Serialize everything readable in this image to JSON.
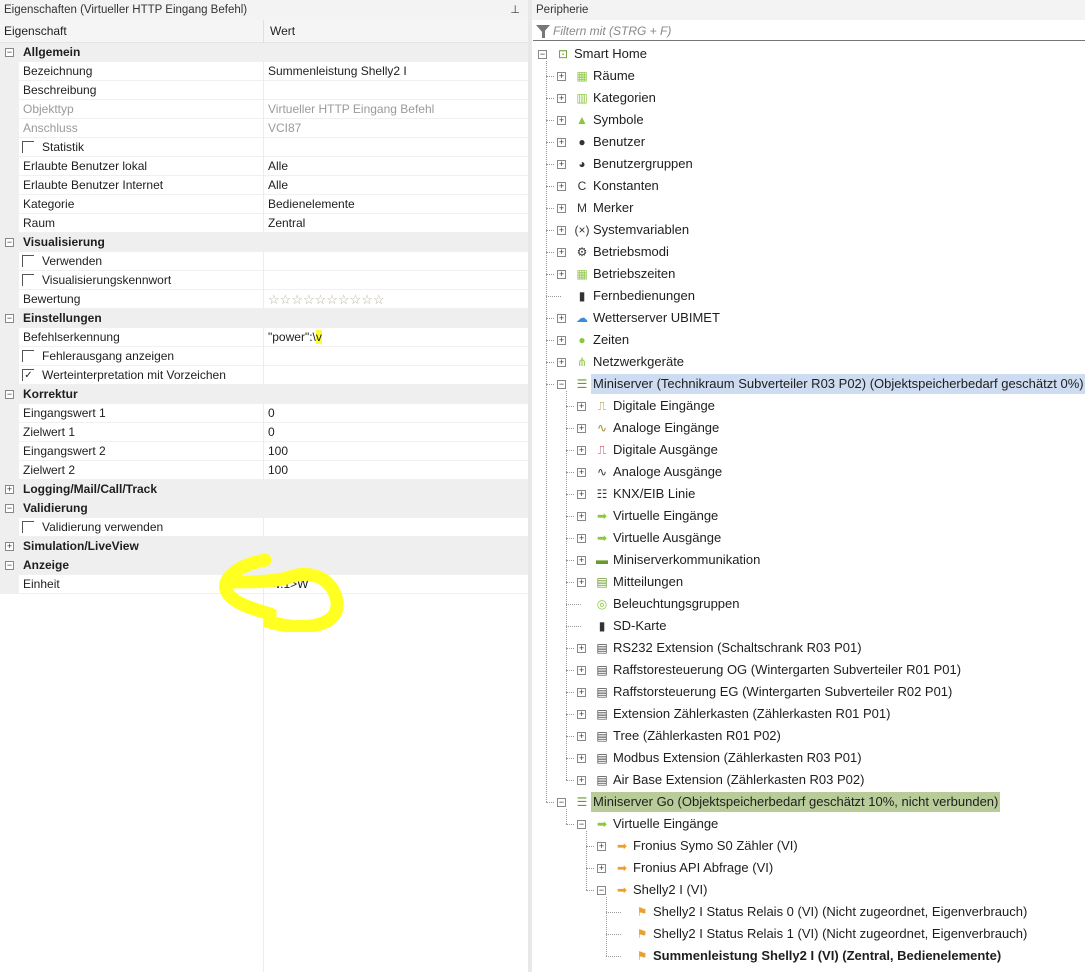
{
  "left": {
    "title": "Eigenschaften (Virtueller HTTP Eingang Befehl)",
    "pin_icon": "pin-icon",
    "col_property": "Eigenschaft",
    "col_value": "Wert",
    "rows": [
      {
        "type": "cat",
        "label": "Allgemein",
        "expanded": true
      },
      {
        "label": "Bezeichnung",
        "value": "Summenleistung Shelly2 I"
      },
      {
        "label": "Beschreibung",
        "value": ""
      },
      {
        "label": "Objekttyp",
        "value": "Virtueller HTTP Eingang Befehl",
        "disabled": true
      },
      {
        "label": "Anschluss",
        "value": "VCI87",
        "disabled": true
      },
      {
        "label": "Statistik",
        "checkbox": true,
        "checked": false
      },
      {
        "label": "Erlaubte Benutzer lokal",
        "value": "Alle"
      },
      {
        "label": "Erlaubte Benutzer Internet",
        "value": "Alle"
      },
      {
        "label": "Kategorie",
        "value": "Bedienelemente"
      },
      {
        "label": "Raum",
        "value": "Zentral"
      },
      {
        "type": "cat",
        "label": "Visualisierung",
        "expanded": true
      },
      {
        "label": "Verwenden",
        "checkbox": true,
        "checked": false
      },
      {
        "label": "Visualisierungskennwort",
        "checkbox": true,
        "checked": false
      },
      {
        "label": "Bewertung",
        "rating": 0,
        "rating_max": 10,
        "stars": "☆☆☆☆☆☆☆☆☆☆"
      },
      {
        "type": "cat",
        "label": "Einstellungen",
        "expanded": true
      },
      {
        "label": "Befehlserkennung",
        "value": "\"power\":\\",
        "value_highlight": "v"
      },
      {
        "label": "Fehlerausgang anzeigen",
        "checkbox": true,
        "checked": false
      },
      {
        "label": "Werteinterpretation mit Vorzeichen",
        "checkbox": true,
        "checked": true
      },
      {
        "type": "cat",
        "label": "Korrektur",
        "expanded": true
      },
      {
        "label": "Eingangswert 1",
        "value": "0"
      },
      {
        "label": "Zielwert 1",
        "value": "0"
      },
      {
        "label": "Eingangswert 2",
        "value": "100"
      },
      {
        "label": "Zielwert 2",
        "value": "100"
      },
      {
        "type": "cat",
        "label": "Logging/Mail/Call/Track",
        "expanded": false
      },
      {
        "type": "cat",
        "label": "Validierung",
        "expanded": true
      },
      {
        "label": "Validierung verwenden",
        "checkbox": true,
        "checked": false
      },
      {
        "type": "cat",
        "label": "Simulation/LiveView",
        "expanded": false
      },
      {
        "type": "cat",
        "label": "Anzeige",
        "expanded": true
      },
      {
        "label": "Einheit",
        "value": "<v.1>W"
      }
    ],
    "annotation_color": "#ffff00"
  },
  "right": {
    "title": "Peripherie",
    "filter_placeholder": "Filtern mit (STRG + F)",
    "tree": [
      {
        "level": 0,
        "exp": "-",
        "icon": "smart-home-icon",
        "glyph": "⊡",
        "color": "#6a9a2a",
        "label": "Smart Home"
      },
      {
        "level": 1,
        "exp": "+",
        "icon": "rooms-icon",
        "glyph": "▦",
        "color": "#8cc63f",
        "label": "Räume"
      },
      {
        "level": 1,
        "exp": "+",
        "icon": "categories-icon",
        "glyph": "▥",
        "color": "#8cc63f",
        "label": "Kategorien"
      },
      {
        "level": 1,
        "exp": "+",
        "icon": "symbols-icon",
        "glyph": "▲",
        "color": "#8cc63f",
        "label": "Symbole"
      },
      {
        "level": 1,
        "exp": "+",
        "icon": "user-icon",
        "glyph": "●",
        "color": "#333",
        "label": "Benutzer"
      },
      {
        "level": 1,
        "exp": "+",
        "icon": "user-group-icon",
        "glyph": "◕",
        "color": "#333",
        "label": "Benutzergruppen"
      },
      {
        "level": 1,
        "exp": "+",
        "icon": "constant-icon",
        "glyph": "C",
        "color": "#333",
        "label": "Konstanten"
      },
      {
        "level": 1,
        "exp": "+",
        "icon": "flag-icon",
        "glyph": "M",
        "color": "#333",
        "label": "Merker"
      },
      {
        "level": 1,
        "exp": "+",
        "icon": "system-variable-icon",
        "glyph": "(×)",
        "color": "#333",
        "label": "Systemvariablen"
      },
      {
        "level": 1,
        "exp": "+",
        "icon": "gear-icon",
        "glyph": "⚙",
        "color": "#333",
        "label": "Betriebsmodi"
      },
      {
        "level": 1,
        "exp": "+",
        "icon": "calendar-icon",
        "glyph": "▦",
        "color": "#8cc63f",
        "label": "Betriebszeiten"
      },
      {
        "level": 1,
        "exp": "",
        "icon": "remote-icon",
        "glyph": "▮",
        "color": "#333",
        "label": "Fernbedienungen"
      },
      {
        "level": 1,
        "exp": "+",
        "icon": "weather-icon",
        "glyph": "☁",
        "color": "#3a8ad8",
        "label": "Wetterserver UBIMET"
      },
      {
        "level": 1,
        "exp": "+",
        "icon": "clock-icon",
        "glyph": "●",
        "color": "#8cc63f",
        "label": "Zeiten"
      },
      {
        "level": 1,
        "exp": "+",
        "icon": "network-icon",
        "glyph": "⋔",
        "color": "#8cc63f",
        "label": "Netzwerkgeräte"
      },
      {
        "level": 1,
        "exp": "-",
        "icon": "miniserver-icon",
        "glyph": "☰",
        "color": "#6a9a2a",
        "label": "Miniserver (Technikraum Subverteiler R03 P02) (Objektspeicherbedarf geschätzt 0%)",
        "state": "sel"
      },
      {
        "level": 2,
        "exp": "+",
        "icon": "digital-input-icon",
        "glyph": "⎍",
        "color": "#a08a30",
        "label": "Digitale Eingänge"
      },
      {
        "level": 2,
        "exp": "+",
        "icon": "analog-input-icon",
        "glyph": "∿",
        "color": "#a08a30",
        "label": "Analoge Eingänge"
      },
      {
        "level": 2,
        "exp": "+",
        "icon": "digital-output-icon",
        "glyph": "⎍",
        "color": "#c03030",
        "label": "Digitale Ausgänge"
      },
      {
        "level": 2,
        "exp": "+",
        "icon": "analog-output-icon",
        "glyph": "∿",
        "color": "#333",
        "label": "Analoge Ausgänge"
      },
      {
        "level": 2,
        "exp": "+",
        "icon": "knx-icon",
        "glyph": "☷",
        "color": "#333",
        "label": "KNX/EIB Linie"
      },
      {
        "level": 2,
        "exp": "+",
        "icon": "virtual-input-icon",
        "glyph": "➡",
        "color": "#8cc63f",
        "label": "Virtuelle Eingänge"
      },
      {
        "level": 2,
        "exp": "+",
        "icon": "virtual-output-icon",
        "glyph": "➡",
        "color": "#8cc63f",
        "label": "Virtuelle Ausgänge"
      },
      {
        "level": 2,
        "exp": "+",
        "icon": "miniserver-communication-icon",
        "glyph": "▬",
        "color": "#6a9a2a",
        "label": "Miniserverkommunikation"
      },
      {
        "level": 2,
        "exp": "+",
        "icon": "log-icon",
        "glyph": "▤",
        "color": "#6a9a2a",
        "label": "Mitteilungen"
      },
      {
        "level": 2,
        "exp": "",
        "icon": "lighting-group-icon",
        "glyph": "◎",
        "color": "#8cc63f",
        "label": "Beleuchtungsgruppen"
      },
      {
        "level": 2,
        "exp": "",
        "icon": "sd-card-icon",
        "glyph": "▮",
        "color": "#333",
        "label": "SD-Karte"
      },
      {
        "level": 2,
        "exp": "+",
        "icon": "extension-icon",
        "glyph": "▤",
        "color": "#444",
        "label": "RS232 Extension (Schaltschrank R03 P01)"
      },
      {
        "level": 2,
        "exp": "+",
        "icon": "extension-icon",
        "glyph": "▤",
        "color": "#444",
        "label": "Raffstoresteuerung OG (Wintergarten Subverteiler R01 P01)"
      },
      {
        "level": 2,
        "exp": "+",
        "icon": "extension-icon",
        "glyph": "▤",
        "color": "#444",
        "label": "Raffstorsteuerung EG (Wintergarten Subverteiler R02 P01)"
      },
      {
        "level": 2,
        "exp": "+",
        "icon": "extension-icon",
        "glyph": "▤",
        "color": "#444",
        "label": "Extension Zählerkasten (Zählerkasten R01 P01)"
      },
      {
        "level": 2,
        "exp": "+",
        "icon": "tree-extension-icon",
        "glyph": "▤",
        "color": "#444",
        "label": "Tree (Zählerkasten R01 P02)"
      },
      {
        "level": 2,
        "exp": "+",
        "icon": "modbus-extension-icon",
        "glyph": "▤",
        "color": "#444",
        "label": "Modbus Extension (Zählerkasten R03 P01)"
      },
      {
        "level": 2,
        "exp": "+",
        "icon": "air-base-icon",
        "glyph": "▤",
        "color": "#444",
        "label": "Air Base Extension (Zählerkasten R03 P02)"
      },
      {
        "level": 1,
        "exp": "-",
        "icon": "miniserver-go-icon",
        "glyph": "☰",
        "color": "#6a9a2a",
        "label": "Miniserver Go (Objektspeicherbedarf geschätzt 10%, nicht verbunden)",
        "state": "sel2"
      },
      {
        "level": 2,
        "exp": "-",
        "icon": "virtual-input-icon",
        "glyph": "➡",
        "color": "#8cc63f",
        "label": "Virtuelle Eingänge"
      },
      {
        "level": 3,
        "exp": "+",
        "icon": "virtual-http-input-icon",
        "glyph": "➡",
        "color": "#e8a030",
        "label": "Fronius Symo S0 Zähler (VI)"
      },
      {
        "level": 3,
        "exp": "+",
        "icon": "virtual-http-input-icon",
        "glyph": "➡",
        "color": "#e8a030",
        "label": "Fronius API Abfrage (VI)"
      },
      {
        "level": 3,
        "exp": "-",
        "icon": "virtual-http-input-icon",
        "glyph": "➡",
        "color": "#e8a030",
        "label": "Shelly2 I (VI)"
      },
      {
        "level": 4,
        "exp": "",
        "icon": "http-command-icon",
        "glyph": "⚑",
        "color": "#e8a030",
        "label": "Shelly2 I Status Relais 0 (VI) (Nicht zugeordnet, Eigenverbrauch)"
      },
      {
        "level": 4,
        "exp": "",
        "icon": "http-command-icon",
        "glyph": "⚑",
        "color": "#e8a030",
        "label": "Shelly2 I Status Relais 1 (VI) (Nicht zugeordnet, Eigenverbrauch)"
      },
      {
        "level": 4,
        "exp": "",
        "icon": "http-command-icon",
        "glyph": "⚑",
        "color": "#e8a030",
        "label": "Summenleistung Shelly2 I (VI) (Zentral, Bedienelemente)",
        "state": "bold"
      }
    ]
  }
}
